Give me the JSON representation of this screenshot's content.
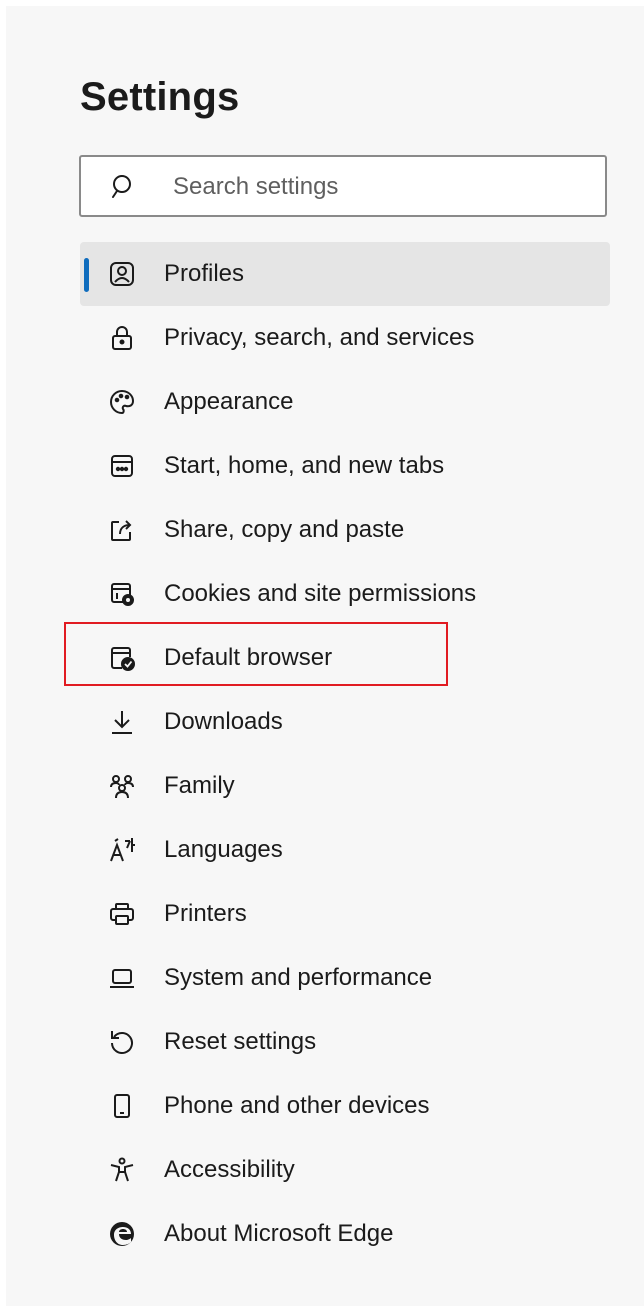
{
  "page": {
    "title": "Settings"
  },
  "search": {
    "placeholder": "Search settings",
    "icon": "search-icon"
  },
  "nav": {
    "items": [
      {
        "label": "Profiles",
        "icon": "profile-icon",
        "selected": true
      },
      {
        "label": "Privacy, search, and services",
        "icon": "lock-icon"
      },
      {
        "label": "Appearance",
        "icon": "palette-icon"
      },
      {
        "label": "Start, home, and new tabs",
        "icon": "new-tab-icon"
      },
      {
        "label": "Share, copy and paste",
        "icon": "share-icon"
      },
      {
        "label": "Cookies and site permissions",
        "icon": "cookies-permissions-icon"
      },
      {
        "label": "Default browser",
        "icon": "default-browser-icon"
      },
      {
        "label": "Downloads",
        "icon": "download-icon"
      },
      {
        "label": "Family",
        "icon": "family-icon"
      },
      {
        "label": "Languages",
        "icon": "languages-icon"
      },
      {
        "label": "Printers",
        "icon": "printer-icon"
      },
      {
        "label": "System and performance",
        "icon": "laptop-icon"
      },
      {
        "label": "Reset settings",
        "icon": "reset-icon"
      },
      {
        "label": "Phone and other devices",
        "icon": "phone-icon"
      },
      {
        "label": "Accessibility",
        "icon": "accessibility-icon"
      },
      {
        "label": "About Microsoft Edge",
        "icon": "edge-logo-icon"
      }
    ]
  },
  "colors": {
    "accent": "#0f6cbd",
    "highlight_box": "#e11b22",
    "selected_bg": "#e5e5e5",
    "panel_bg": "#f7f7f7"
  }
}
